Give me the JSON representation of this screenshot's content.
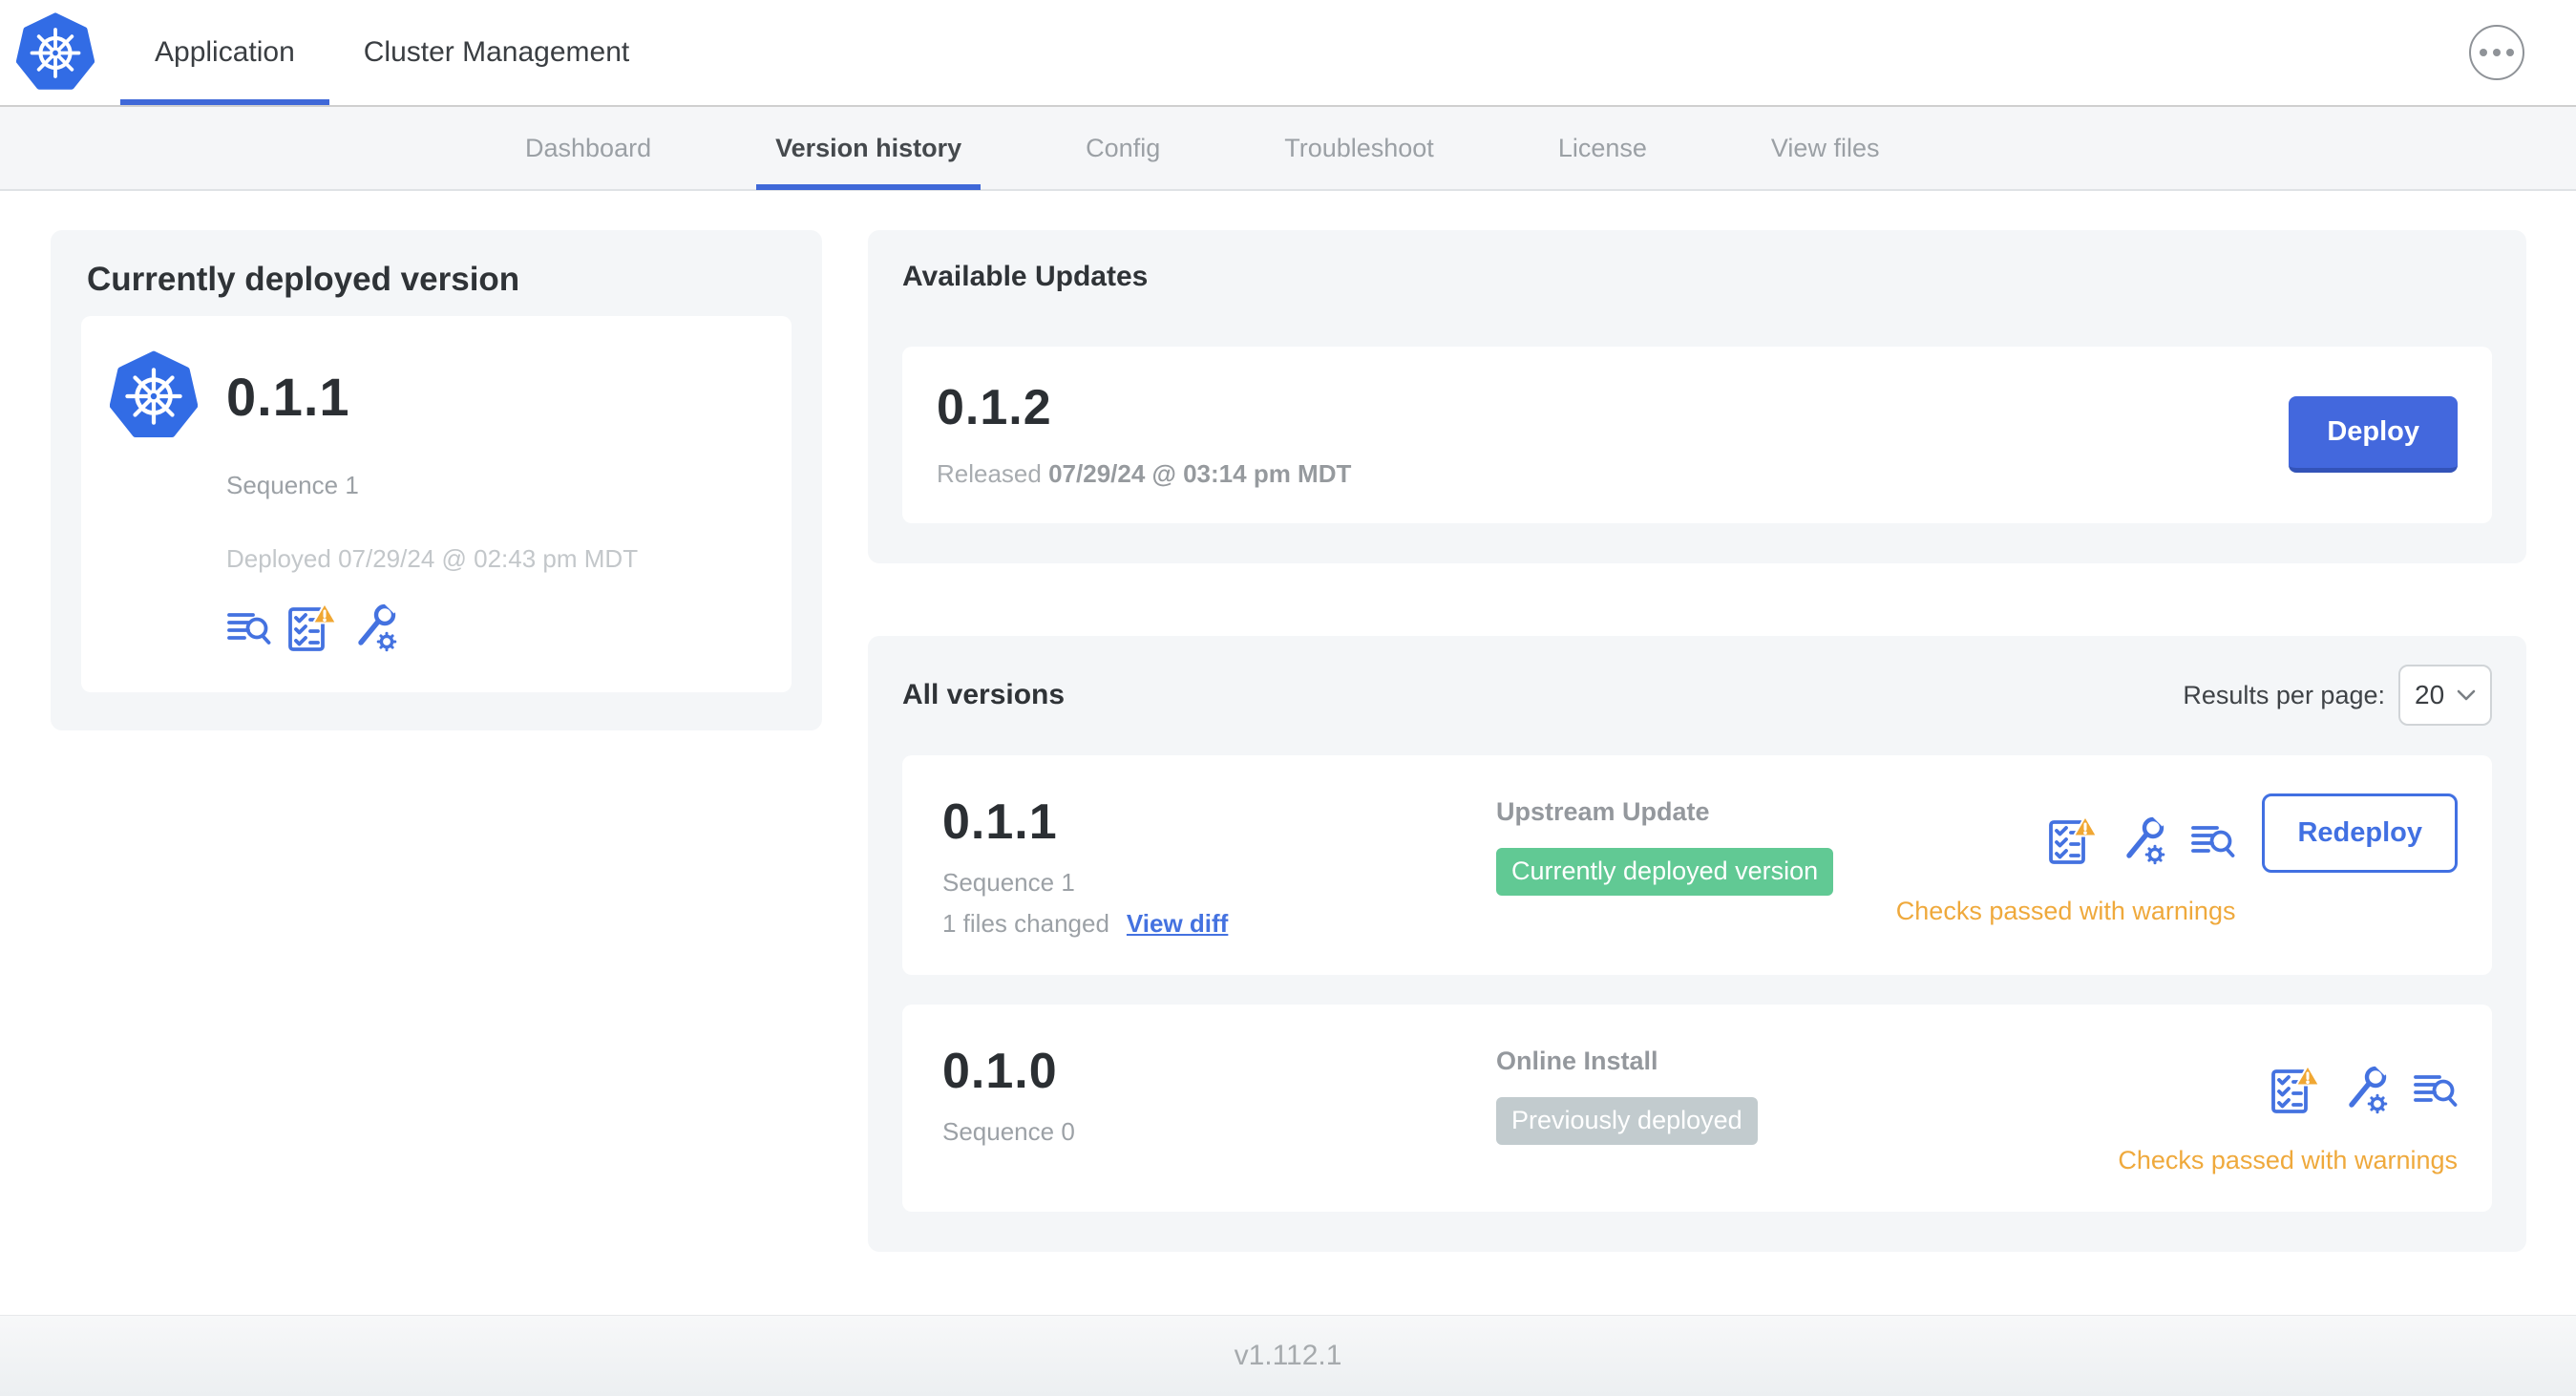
{
  "header": {
    "tabs": [
      {
        "label": "Application"
      },
      {
        "label": "Cluster Management"
      }
    ]
  },
  "subnav": {
    "items": [
      {
        "label": "Dashboard"
      },
      {
        "label": "Version history"
      },
      {
        "label": "Config"
      },
      {
        "label": "Troubleshoot"
      },
      {
        "label": "License"
      },
      {
        "label": "View files"
      }
    ]
  },
  "current_version": {
    "title": "Currently deployed version",
    "version": "0.1.1",
    "sequence": "Sequence 1",
    "deployed": "Deployed 07/29/24 @ 02:43 pm MDT"
  },
  "available_updates": {
    "title": "Available Updates",
    "version": "0.1.2",
    "released_label": "Released",
    "released_value": "07/29/24 @ 03:14 pm MDT",
    "deploy_label": "Deploy"
  },
  "all_versions": {
    "title": "All versions",
    "results_per_page_label": "Results per page:",
    "results_per_page_value": "20",
    "rows": [
      {
        "version": "0.1.1",
        "sequence": "Sequence 1",
        "files_changed": "1 files changed",
        "view_diff_label": "View diff",
        "source": "Upstream Update",
        "badge": "Currently deployed version",
        "badge_color": "#61c994",
        "status": "Checks passed with warnings",
        "action_label": "Redeploy"
      },
      {
        "version": "0.1.0",
        "sequence": "Sequence 0",
        "source": "Online Install",
        "badge": "Previously deployed",
        "badge_color": "#c2cbce",
        "status": "Checks passed with warnings"
      }
    ]
  },
  "footer": {
    "version": "v1.112.1"
  },
  "colors": {
    "accent_blue": "#4472e0",
    "k8s_blue": "#326ce5",
    "deploy_blue": "#4368dd",
    "badge_green": "#61c994",
    "badge_gray": "#c2cbce",
    "warning_orange": "#efa93c"
  }
}
